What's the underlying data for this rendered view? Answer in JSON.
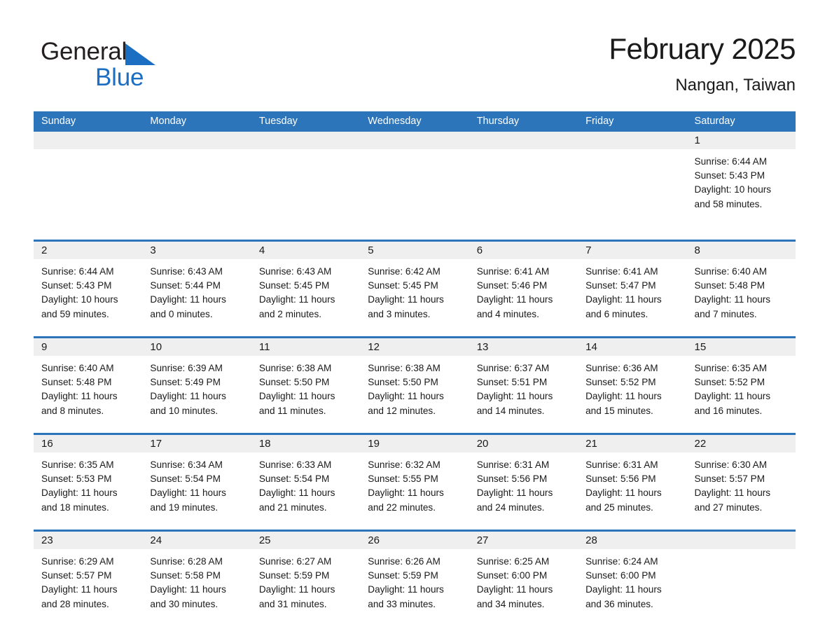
{
  "brand": {
    "name_part1": "General",
    "name_part2": "Blue",
    "triangle_color": "#1b6ec2"
  },
  "header": {
    "title": "February 2025",
    "location": "Nangan, Taiwan"
  },
  "theme": {
    "header_blue": "#2c75ba",
    "daynum_band": "#efefef",
    "text": "#1a1a1a"
  },
  "weekdays": [
    "Sunday",
    "Monday",
    "Tuesday",
    "Wednesday",
    "Thursday",
    "Friday",
    "Saturday"
  ],
  "weeks": [
    [
      {
        "day": "",
        "sunrise": "",
        "sunset": "",
        "daylight_line1": "",
        "daylight_line2": ""
      },
      {
        "day": "",
        "sunrise": "",
        "sunset": "",
        "daylight_line1": "",
        "daylight_line2": ""
      },
      {
        "day": "",
        "sunrise": "",
        "sunset": "",
        "daylight_line1": "",
        "daylight_line2": ""
      },
      {
        "day": "",
        "sunrise": "",
        "sunset": "",
        "daylight_line1": "",
        "daylight_line2": ""
      },
      {
        "day": "",
        "sunrise": "",
        "sunset": "",
        "daylight_line1": "",
        "daylight_line2": ""
      },
      {
        "day": "",
        "sunrise": "",
        "sunset": "",
        "daylight_line1": "",
        "daylight_line2": ""
      },
      {
        "day": "1",
        "sunrise": "Sunrise: 6:44 AM",
        "sunset": "Sunset: 5:43 PM",
        "daylight_line1": "Daylight: 10 hours",
        "daylight_line2": "and 58 minutes."
      }
    ],
    [
      {
        "day": "2",
        "sunrise": "Sunrise: 6:44 AM",
        "sunset": "Sunset: 5:43 PM",
        "daylight_line1": "Daylight: 10 hours",
        "daylight_line2": "and 59 minutes."
      },
      {
        "day": "3",
        "sunrise": "Sunrise: 6:43 AM",
        "sunset": "Sunset: 5:44 PM",
        "daylight_line1": "Daylight: 11 hours",
        "daylight_line2": "and 0 minutes."
      },
      {
        "day": "4",
        "sunrise": "Sunrise: 6:43 AM",
        "sunset": "Sunset: 5:45 PM",
        "daylight_line1": "Daylight: 11 hours",
        "daylight_line2": "and 2 minutes."
      },
      {
        "day": "5",
        "sunrise": "Sunrise: 6:42 AM",
        "sunset": "Sunset: 5:45 PM",
        "daylight_line1": "Daylight: 11 hours",
        "daylight_line2": "and 3 minutes."
      },
      {
        "day": "6",
        "sunrise": "Sunrise: 6:41 AM",
        "sunset": "Sunset: 5:46 PM",
        "daylight_line1": "Daylight: 11 hours",
        "daylight_line2": "and 4 minutes."
      },
      {
        "day": "7",
        "sunrise": "Sunrise: 6:41 AM",
        "sunset": "Sunset: 5:47 PM",
        "daylight_line1": "Daylight: 11 hours",
        "daylight_line2": "and 6 minutes."
      },
      {
        "day": "8",
        "sunrise": "Sunrise: 6:40 AM",
        "sunset": "Sunset: 5:48 PM",
        "daylight_line1": "Daylight: 11 hours",
        "daylight_line2": "and 7 minutes."
      }
    ],
    [
      {
        "day": "9",
        "sunrise": "Sunrise: 6:40 AM",
        "sunset": "Sunset: 5:48 PM",
        "daylight_line1": "Daylight: 11 hours",
        "daylight_line2": "and 8 minutes."
      },
      {
        "day": "10",
        "sunrise": "Sunrise: 6:39 AM",
        "sunset": "Sunset: 5:49 PM",
        "daylight_line1": "Daylight: 11 hours",
        "daylight_line2": "and 10 minutes."
      },
      {
        "day": "11",
        "sunrise": "Sunrise: 6:38 AM",
        "sunset": "Sunset: 5:50 PM",
        "daylight_line1": "Daylight: 11 hours",
        "daylight_line2": "and 11 minutes."
      },
      {
        "day": "12",
        "sunrise": "Sunrise: 6:38 AM",
        "sunset": "Sunset: 5:50 PM",
        "daylight_line1": "Daylight: 11 hours",
        "daylight_line2": "and 12 minutes."
      },
      {
        "day": "13",
        "sunrise": "Sunrise: 6:37 AM",
        "sunset": "Sunset: 5:51 PM",
        "daylight_line1": "Daylight: 11 hours",
        "daylight_line2": "and 14 minutes."
      },
      {
        "day": "14",
        "sunrise": "Sunrise: 6:36 AM",
        "sunset": "Sunset: 5:52 PM",
        "daylight_line1": "Daylight: 11 hours",
        "daylight_line2": "and 15 minutes."
      },
      {
        "day": "15",
        "sunrise": "Sunrise: 6:35 AM",
        "sunset": "Sunset: 5:52 PM",
        "daylight_line1": "Daylight: 11 hours",
        "daylight_line2": "and 16 minutes."
      }
    ],
    [
      {
        "day": "16",
        "sunrise": "Sunrise: 6:35 AM",
        "sunset": "Sunset: 5:53 PM",
        "daylight_line1": "Daylight: 11 hours",
        "daylight_line2": "and 18 minutes."
      },
      {
        "day": "17",
        "sunrise": "Sunrise: 6:34 AM",
        "sunset": "Sunset: 5:54 PM",
        "daylight_line1": "Daylight: 11 hours",
        "daylight_line2": "and 19 minutes."
      },
      {
        "day": "18",
        "sunrise": "Sunrise: 6:33 AM",
        "sunset": "Sunset: 5:54 PM",
        "daylight_line1": "Daylight: 11 hours",
        "daylight_line2": "and 21 minutes."
      },
      {
        "day": "19",
        "sunrise": "Sunrise: 6:32 AM",
        "sunset": "Sunset: 5:55 PM",
        "daylight_line1": "Daylight: 11 hours",
        "daylight_line2": "and 22 minutes."
      },
      {
        "day": "20",
        "sunrise": "Sunrise: 6:31 AM",
        "sunset": "Sunset: 5:56 PM",
        "daylight_line1": "Daylight: 11 hours",
        "daylight_line2": "and 24 minutes."
      },
      {
        "day": "21",
        "sunrise": "Sunrise: 6:31 AM",
        "sunset": "Sunset: 5:56 PM",
        "daylight_line1": "Daylight: 11 hours",
        "daylight_line2": "and 25 minutes."
      },
      {
        "day": "22",
        "sunrise": "Sunrise: 6:30 AM",
        "sunset": "Sunset: 5:57 PM",
        "daylight_line1": "Daylight: 11 hours",
        "daylight_line2": "and 27 minutes."
      }
    ],
    [
      {
        "day": "23",
        "sunrise": "Sunrise: 6:29 AM",
        "sunset": "Sunset: 5:57 PM",
        "daylight_line1": "Daylight: 11 hours",
        "daylight_line2": "and 28 minutes."
      },
      {
        "day": "24",
        "sunrise": "Sunrise: 6:28 AM",
        "sunset": "Sunset: 5:58 PM",
        "daylight_line1": "Daylight: 11 hours",
        "daylight_line2": "and 30 minutes."
      },
      {
        "day": "25",
        "sunrise": "Sunrise: 6:27 AM",
        "sunset": "Sunset: 5:59 PM",
        "daylight_line1": "Daylight: 11 hours",
        "daylight_line2": "and 31 minutes."
      },
      {
        "day": "26",
        "sunrise": "Sunrise: 6:26 AM",
        "sunset": "Sunset: 5:59 PM",
        "daylight_line1": "Daylight: 11 hours",
        "daylight_line2": "and 33 minutes."
      },
      {
        "day": "27",
        "sunrise": "Sunrise: 6:25 AM",
        "sunset": "Sunset: 6:00 PM",
        "daylight_line1": "Daylight: 11 hours",
        "daylight_line2": "and 34 minutes."
      },
      {
        "day": "28",
        "sunrise": "Sunrise: 6:24 AM",
        "sunset": "Sunset: 6:00 PM",
        "daylight_line1": "Daylight: 11 hours",
        "daylight_line2": "and 36 minutes."
      },
      {
        "day": "",
        "sunrise": "",
        "sunset": "",
        "daylight_line1": "",
        "daylight_line2": ""
      }
    ]
  ]
}
